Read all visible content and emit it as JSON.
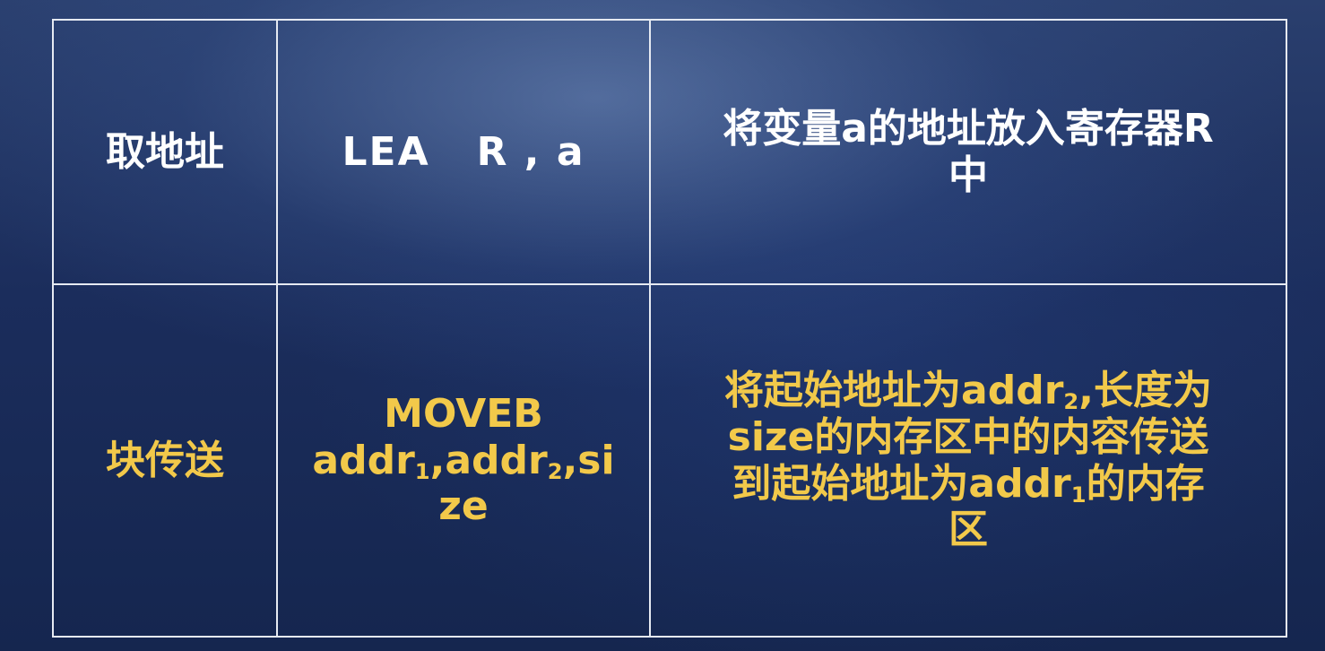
{
  "table": {
    "rows": [
      {
        "name": "取地址",
        "instruction": "LEA   R , a",
        "description_lines": [
          "将变量a的地址放入寄存器R",
          "中"
        ]
      },
      {
        "name": "块传送",
        "instruction_lines": [
          "MOVEB",
          "addr",
          "1",
          ",addr",
          "2",
          ",si",
          "ze"
        ],
        "description_parts": {
          "l1a": "将起始地址为addr",
          "l1sub": "2",
          "l1b": ",长度为",
          "l2": "size的内存区中的内容传送",
          "l3a": "到起始地址为addr",
          "l3sub": "1",
          "l3b": "的内存",
          "l4": "区"
        }
      }
    ]
  },
  "colors": {
    "text_primary": "#ffffff",
    "text_highlight": "#f2c94a",
    "grid_line": "#e6eaf2",
    "background": "#1b2d5c"
  }
}
